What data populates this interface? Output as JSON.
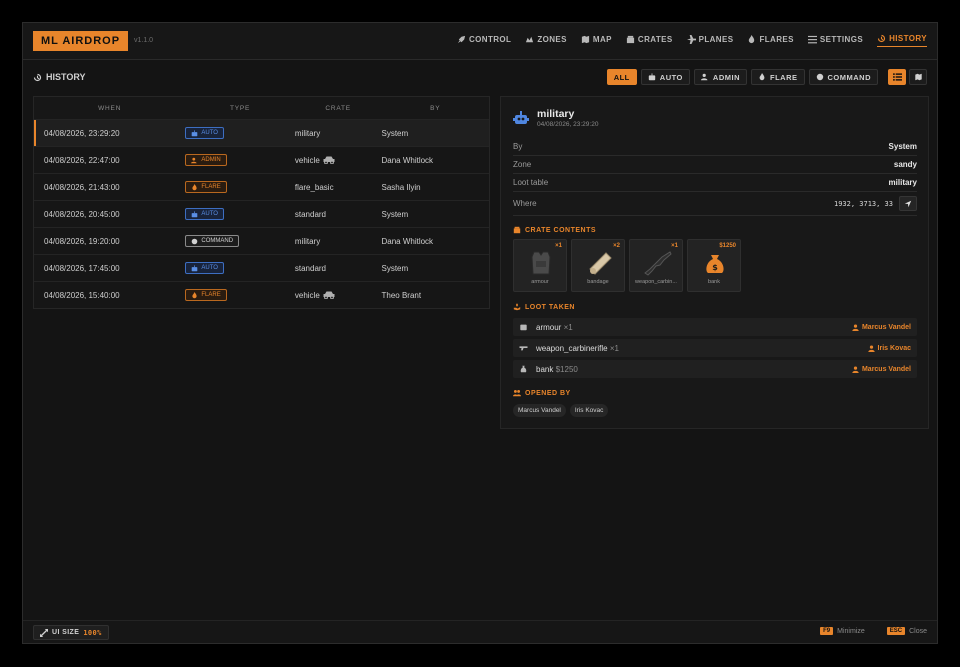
{
  "header": {
    "brand": "ML AIRDROP",
    "version": "v1.1.0",
    "nav": [
      {
        "label": "CONTROL",
        "icon": "rocket-icon"
      },
      {
        "label": "ZONES",
        "icon": "zones-icon"
      },
      {
        "label": "MAP",
        "icon": "map-icon"
      },
      {
        "label": "CRATES",
        "icon": "crate-icon"
      },
      {
        "label": "PLANES",
        "icon": "plane-icon"
      },
      {
        "label": "FLARES",
        "icon": "flame-icon"
      },
      {
        "label": "SETTINGS",
        "icon": "sliders-icon"
      },
      {
        "label": "HISTORY",
        "icon": "history-icon",
        "active": true
      }
    ]
  },
  "page": {
    "title": "HISTORY",
    "filters": [
      "ALL",
      "AUTO",
      "ADMIN",
      "FLARE",
      "COMMAND"
    ],
    "active_filter": "ALL"
  },
  "table": {
    "columns": [
      "WHEN",
      "TYPE",
      "CRATE",
      "BY"
    ],
    "rows": [
      {
        "when": "04/08/2026, 23:29:20",
        "type": "AUTO",
        "crate": "military",
        "by": "System",
        "vehicle": false
      },
      {
        "when": "04/08/2026, 22:47:00",
        "type": "ADMIN",
        "crate": "vehicle",
        "by": "Dana Whitlock",
        "vehicle": true
      },
      {
        "when": "04/08/2026, 21:43:00",
        "type": "FLARE",
        "crate": "flare_basic",
        "by": "Sasha Ilyin",
        "vehicle": false
      },
      {
        "when": "04/08/2026, 20:45:00",
        "type": "AUTO",
        "crate": "standard",
        "by": "System",
        "vehicle": false
      },
      {
        "when": "04/08/2026, 19:20:00",
        "type": "COMMAND",
        "crate": "military",
        "by": "Dana Whitlock",
        "vehicle": false
      },
      {
        "when": "04/08/2026, 17:45:00",
        "type": "AUTO",
        "crate": "standard",
        "by": "System",
        "vehicle": false
      },
      {
        "when": "04/08/2026, 15:40:00",
        "type": "FLARE",
        "crate": "vehicle",
        "by": "Theo Brant",
        "vehicle": true
      }
    ]
  },
  "detail": {
    "title": "military",
    "subtitle": "04/08/2026, 23:29:20",
    "fields": {
      "by_label": "By",
      "by_value": "System",
      "zone_label": "Zone",
      "zone_value": "sandy",
      "loot_label": "Loot table",
      "loot_value": "military",
      "where_label": "Where",
      "where_value": "1932, 3713, 33"
    },
    "contents_title": "CRATE CONTENTS",
    "contents": [
      {
        "name": "armour",
        "qty": "×1"
      },
      {
        "name": "bandage",
        "qty": "×2"
      },
      {
        "name": "weapon_carbin...",
        "qty": "×1"
      },
      {
        "name": "bank",
        "qty": "$1250"
      }
    ],
    "loot_taken_title": "LOOT TAKEN",
    "loot_taken": [
      {
        "item": "armour",
        "qty": "×1",
        "who": "Marcus Vandel"
      },
      {
        "item": "weapon_carbinerifle",
        "qty": "×1",
        "who": "Iris Kovac"
      },
      {
        "item": "bank",
        "qty": "$1250",
        "who": "Marcus Vandel"
      }
    ],
    "opened_by_title": "OPENED BY",
    "opened_by": [
      "Marcus Vandel",
      "Iris Kovac"
    ]
  },
  "footer": {
    "ui_size_label": "UI SIZE",
    "ui_size_value": "100%",
    "minimize_key": "F9",
    "minimize_label": "Minimize",
    "close_key": "ESC",
    "close_label": "Close"
  },
  "colors": {
    "accent": "#e8852b",
    "auto": "#5a8fe6",
    "background": "#141414"
  }
}
